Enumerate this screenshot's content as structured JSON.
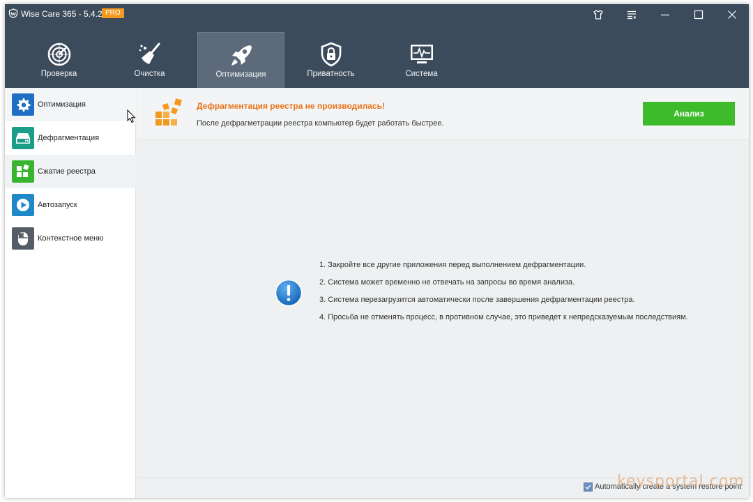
{
  "window": {
    "title": "Wise Care 365 - 5.4.2",
    "badge": "PRO"
  },
  "toolbar": {
    "tabs": [
      {
        "label": "Проверка",
        "icon": "radar-icon"
      },
      {
        "label": "Очистка",
        "icon": "broom-icon"
      },
      {
        "label": "Оптимизация",
        "icon": "rocket-icon",
        "active": true
      },
      {
        "label": "Приватность",
        "icon": "lock-shield-icon"
      },
      {
        "label": "Система",
        "icon": "monitor-pulse-icon"
      }
    ]
  },
  "sidebar": {
    "items": [
      {
        "label": "Оптимизация",
        "icon": "gear-icon",
        "color": "#1f6fc4"
      },
      {
        "label": "Дефрагментация",
        "icon": "drive-icon",
        "color": "#1b9d87"
      },
      {
        "label": "Сжатие реестра",
        "icon": "blocks-icon",
        "color": "#39b42e",
        "active": true
      },
      {
        "label": "Автозапуск",
        "icon": "play-icon",
        "color": "#1e88c9"
      },
      {
        "label": "Контекстное меню",
        "icon": "mouse-icon",
        "color": "#555d66"
      }
    ]
  },
  "main": {
    "header": {
      "title": "Дефрагментация реестра не производилась!",
      "description": "После дефрагметрации реестра компьютер будет работать быстрее.",
      "analyze_label": "Анализ"
    },
    "notes": [
      "1. Закройте все другие приложения перед выполнением дефрагментации.",
      "2. Система может временно не отвечать на запросы во время анализа.",
      "3. Система перезагрузится автоматически после завершения дефрагментации реестра.",
      "4. Просьба не отменять процесс, в противном случае, это приведет к непредсказуемым последствиям."
    ],
    "footer": {
      "restore_label": "Automatically create a system restore point",
      "restore_checked": true
    }
  },
  "watermark": "keysportal.com",
  "colors": {
    "titlebar": "#3c4b5c",
    "accent_orange": "#e8731a",
    "analyze_green": "#3dbb2b",
    "pro_badge": "#f39a1e"
  }
}
